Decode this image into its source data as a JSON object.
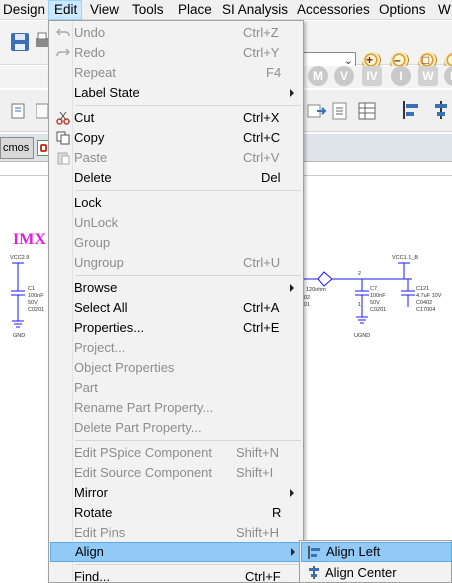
{
  "menubar": {
    "items": [
      "Design",
      "Edit",
      "View",
      "Tools",
      "Place",
      "SI Analysis",
      "Accessories",
      "Options",
      "W"
    ]
  },
  "tabs": {
    "first_label": "cmos"
  },
  "canvas": {
    "title_text": "IMX",
    "labels": {
      "vcc_left": "VCC2.9",
      "c1_name": "C1",
      "c1_value": "100nF",
      "c1_volt": "50V",
      "c1_pkg": "C0201",
      "gnd_left": "GND",
      "r_value": "120ohm",
      "r_pkg_a": "02",
      "r_pkg_b": "01",
      "vcc_right": "VCC1.1_B",
      "c7_name": "C7",
      "c7_value": "100nF",
      "c7_volt": "50V",
      "c7_pkg": "C0201",
      "c121_name": "C121",
      "c121_value": "4.7uF 10V",
      "c121_pkg": "C0402",
      "c121_ref": "C17004",
      "ugnd": "UGND",
      "pin2": "2",
      "pin1": "1"
    }
  },
  "edit_menu": {
    "items": [
      {
        "label": "Undo",
        "shortcut": "Ctrl+Z",
        "disabled": true,
        "icon": "undo-icon"
      },
      {
        "label": "Redo",
        "shortcut": "Ctrl+Y",
        "disabled": true,
        "icon": "redo-icon"
      },
      {
        "label": "Repeat",
        "shortcut": "F4",
        "disabled": true
      },
      {
        "label": "Label State",
        "shortcut": "",
        "disabled": false,
        "submenu": true
      },
      {
        "label": "Cut",
        "shortcut": "Ctrl+X",
        "disabled": false,
        "icon": "scissors-icon"
      },
      {
        "label": "Copy",
        "shortcut": "Ctrl+C",
        "disabled": false,
        "icon": "copy-icon"
      },
      {
        "label": "Paste",
        "shortcut": "Ctrl+V",
        "disabled": true,
        "icon": "paste-icon"
      },
      {
        "label": "Delete",
        "shortcut": "Del",
        "disabled": false
      },
      {
        "label": "Lock",
        "shortcut": "",
        "disabled": false
      },
      {
        "label": "UnLock",
        "shortcut": "",
        "disabled": true
      },
      {
        "label": "Group",
        "shortcut": "",
        "disabled": true
      },
      {
        "label": "Ungroup",
        "shortcut": "Ctrl+U",
        "disabled": true
      },
      {
        "label": "Browse",
        "shortcut": "",
        "disabled": false,
        "submenu": true
      },
      {
        "label": "Select All",
        "shortcut": "Ctrl+A",
        "disabled": false
      },
      {
        "label": "Properties...",
        "shortcut": "Ctrl+E",
        "disabled": false
      },
      {
        "label": "Project...",
        "shortcut": "",
        "disabled": true
      },
      {
        "label": "Object Properties",
        "shortcut": "",
        "disabled": true
      },
      {
        "label": "Part",
        "shortcut": "",
        "disabled": true
      },
      {
        "label": "Rename Part Property...",
        "shortcut": "",
        "disabled": true
      },
      {
        "label": "Delete Part Property...",
        "shortcut": "",
        "disabled": true
      },
      {
        "label": "Edit PSpice Component",
        "shortcut": "Shift+N",
        "disabled": true
      },
      {
        "label": "Edit Source Component",
        "shortcut": "Shift+I",
        "disabled": true
      },
      {
        "label": "Mirror",
        "shortcut": "",
        "disabled": false,
        "submenu": true
      },
      {
        "label": "Rotate",
        "shortcut": "R",
        "disabled": false
      },
      {
        "label": "Edit Pins",
        "shortcut": "Shift+H",
        "disabled": true
      },
      {
        "label": "Align",
        "shortcut": "",
        "disabled": false,
        "submenu": true,
        "highlighted": true
      },
      {
        "label": "Find...",
        "shortcut": "Ctrl+F",
        "disabled": false
      }
    ]
  },
  "align_submenu": {
    "items": [
      {
        "label": "Align Left",
        "icon": "align-left-icon",
        "highlighted": true
      },
      {
        "label": "Align Center",
        "icon": "align-center-icon",
        "highlighted": false
      }
    ]
  },
  "colors": {
    "menu_highlight": "#91c9f7",
    "menubar_active": "#cce8ff",
    "disabled_text": "#8d8d8d",
    "title_magenta": "#e020e0"
  }
}
